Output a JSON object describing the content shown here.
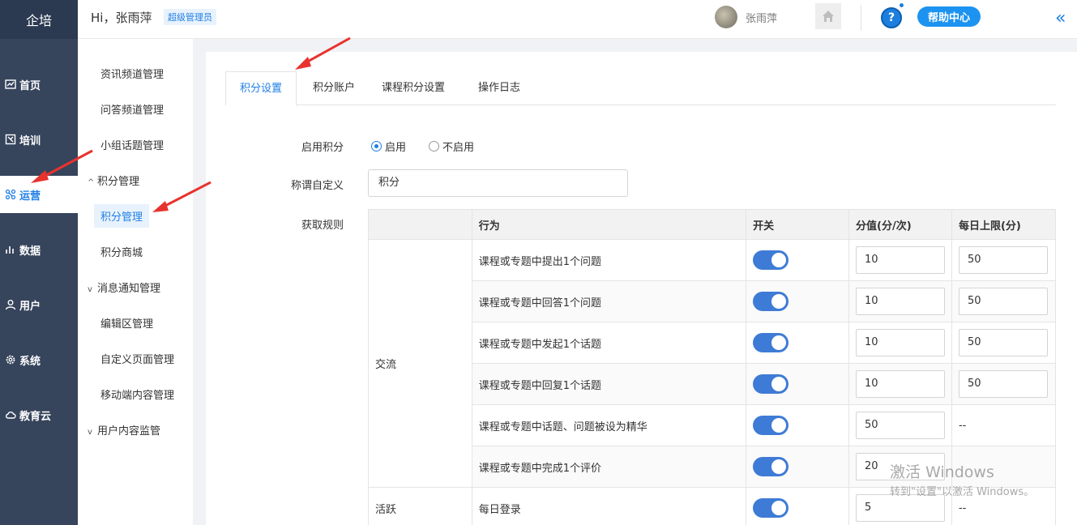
{
  "brand": "企培",
  "header": {
    "greeting": "Hi，张雨萍",
    "role": "超级管理员",
    "username": "张雨萍",
    "help_label": "帮助中心",
    "help_q": "?",
    "collapse_glyph": "«"
  },
  "nav": [
    {
      "label": "首页",
      "icon": "dashboard-icon"
    },
    {
      "label": "培训",
      "icon": "training-icon"
    },
    {
      "label": "运营",
      "icon": "operations-icon",
      "active": true
    },
    {
      "label": "数据",
      "icon": "chart-icon"
    },
    {
      "label": "用户",
      "icon": "user-icon"
    },
    {
      "label": "系统",
      "icon": "gear-icon"
    },
    {
      "label": "教育云",
      "icon": "cloud-icon"
    }
  ],
  "submenu": {
    "items": [
      "资讯频道管理",
      "问答频道管理",
      "小组话题管理"
    ],
    "group_points": "积分管理",
    "points_children": [
      "积分管理",
      "积分商城"
    ],
    "group_notify": "消息通知管理",
    "notify_children": [
      "编辑区管理",
      "自定义页面管理",
      "移动端内容管理"
    ],
    "group_monitor": "用户内容监管",
    "chevron_up": "^",
    "chevron_down": "v"
  },
  "tabs": [
    "积分设置",
    "积分账户",
    "课程积分设置",
    "操作日志"
  ],
  "form": {
    "enable_label": "启用积分",
    "enable_on": "启用",
    "enable_off": "不启用",
    "name_label": "称谓自定义",
    "name_value": "积分",
    "rules_label": "获取规则"
  },
  "table": {
    "headers": [
      "",
      "行为",
      "开关",
      "分值(分/次)",
      "每日上限(分)"
    ],
    "group_exchange": "交流",
    "group_active": "活跃",
    "rows": [
      {
        "action": "课程或专题中提出1个问题",
        "score": "10",
        "limit": "50"
      },
      {
        "action": "课程或专题中回答1个问题",
        "score": "10",
        "limit": "50"
      },
      {
        "action": "课程或专题中发起1个话题",
        "score": "10",
        "limit": "50"
      },
      {
        "action": "课程或专题中回复1个话题",
        "score": "10",
        "limit": "50"
      },
      {
        "action": "课程或专题中话题、问题被设为精华",
        "score": "50",
        "limit": "--"
      },
      {
        "action": "课程或专题中完成1个评价",
        "score": "20",
        "limit": ""
      },
      {
        "action": "每日登录",
        "score": "5",
        "limit": "--"
      }
    ]
  },
  "watermark": {
    "line1": "激活 Windows",
    "line2": "转到\"设置\"以激活 Windows。"
  },
  "colors": {
    "accent": "#1f7fe6",
    "nav_bg": "#36445c",
    "switch_on": "#3e7bd6",
    "annotation_arrow": "#e8322e"
  }
}
